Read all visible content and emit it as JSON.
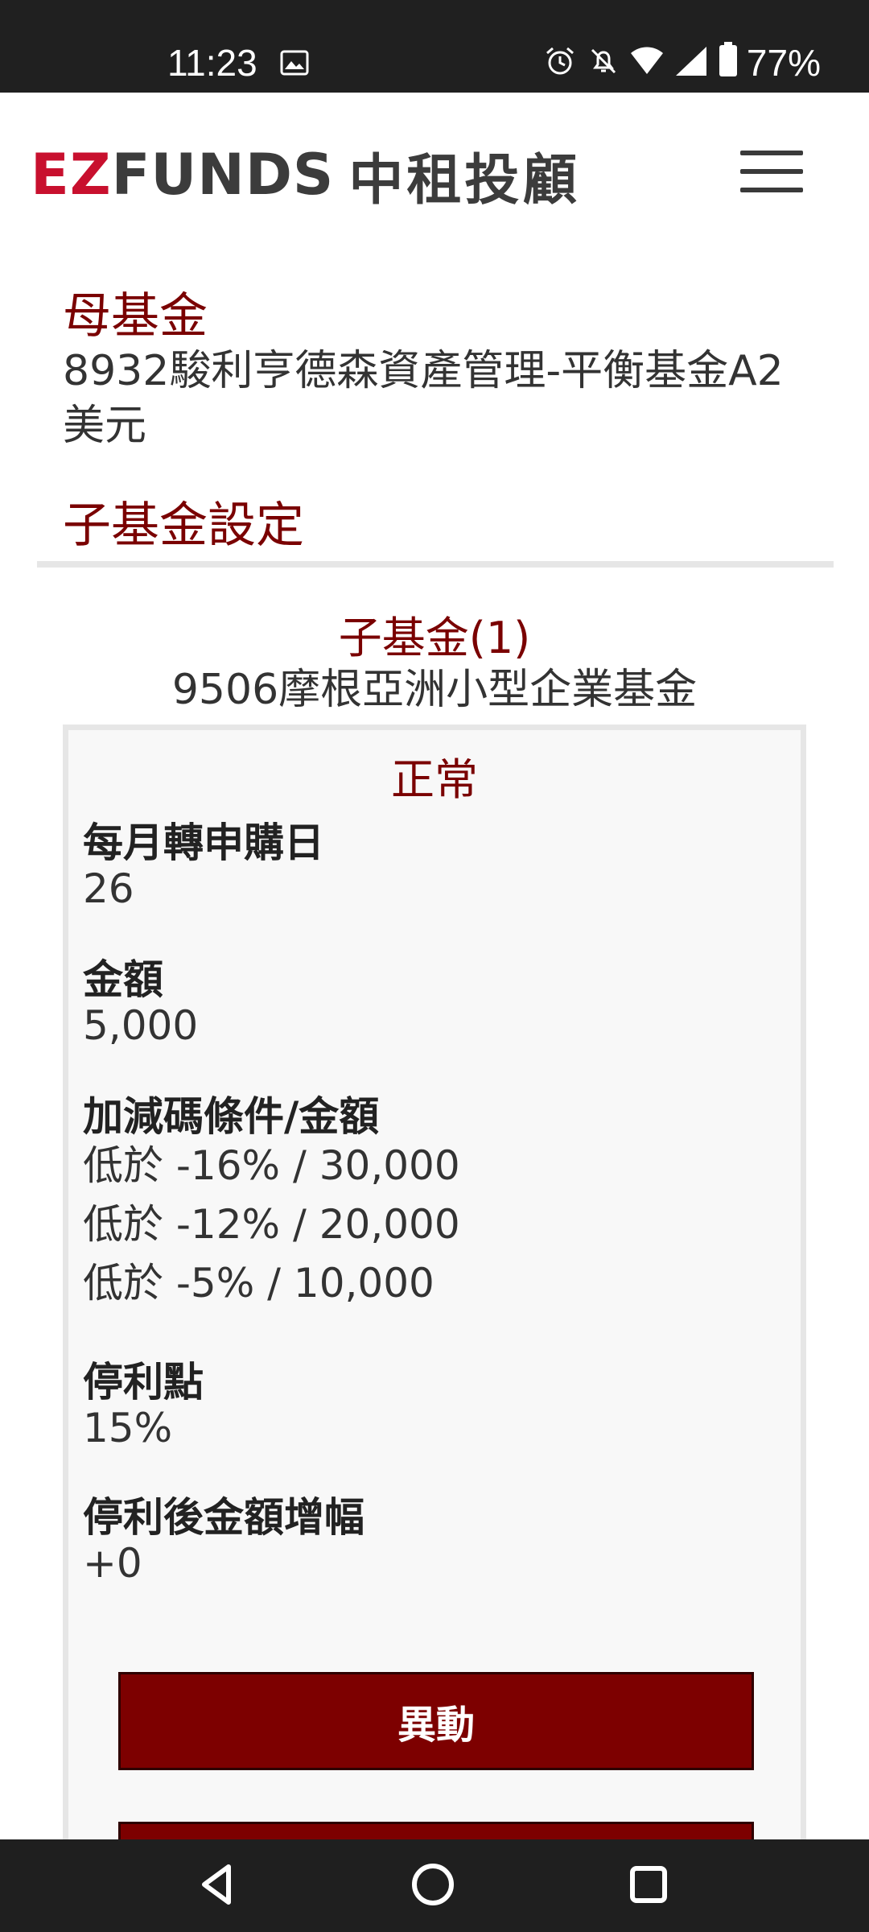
{
  "status_bar": {
    "time": "11:23",
    "battery": "77%",
    "icons": [
      "image-icon",
      "alarm-icon",
      "notifications-off-icon",
      "wifi-icon",
      "signal-icon",
      "battery-icon"
    ]
  },
  "header": {
    "logo_ez": "EZ",
    "logo_funds": "FUNDS",
    "logo_cn": "中租投顧",
    "menu_icon": "hamburger-menu-icon"
  },
  "mother_fund": {
    "title": "母基金",
    "name": "8932駿利亨德森資產管理-平衡基金A2美元"
  },
  "sub_fund_section": {
    "title": "子基金設定"
  },
  "sub_fund": {
    "index_label": "子基金(1)",
    "name": "9506摩根亞洲小型企業基金",
    "status": "正常",
    "monthly_day_label": "每月轉申購日",
    "monthly_day_value": "26",
    "amount_label": "金額",
    "amount_value": "5,000",
    "conditions_label": "加減碼條件/金額",
    "conditions": [
      "低於 -16% / 30,000",
      "低於 -12% / 20,000",
      "低於 -5% / 10,000"
    ],
    "take_profit_label": "停利點",
    "take_profit_value": "15%",
    "post_profit_label": "停利後金額增幅",
    "post_profit_value": "+0",
    "change_button": "異動"
  },
  "nav_bar": {
    "icons": [
      "back-icon",
      "home-icon",
      "recents-icon"
    ]
  }
}
